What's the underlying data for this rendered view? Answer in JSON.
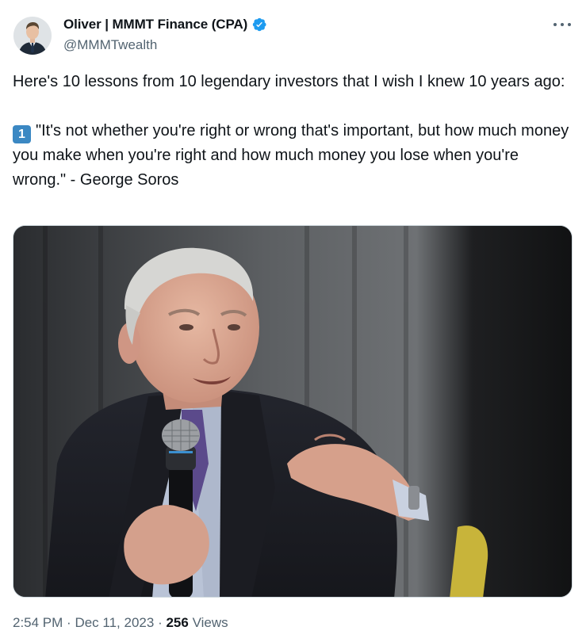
{
  "author": {
    "display_name": "Oliver | MMMT Finance (CPA)",
    "handle": "@MMMTwealth",
    "verified": true,
    "verified_color": "#1d9bf0"
  },
  "tweet": {
    "line1": "Here's 10 lessons from 10 legendary investors that I wish I knew 10 years ago:",
    "keycap": "1",
    "quote": "\"It's not whether you're right or wrong that's important, but how much money you make when you're right and how much money you lose when you're wrong.\" - George Soros"
  },
  "meta": {
    "time": "2:54 PM",
    "separator": "·",
    "date": "Dec 11, 2023",
    "views_count": "256",
    "views_label": "Views"
  },
  "icons": {
    "more": "more-horizontal-icon",
    "verified": "verified-badge-icon"
  }
}
